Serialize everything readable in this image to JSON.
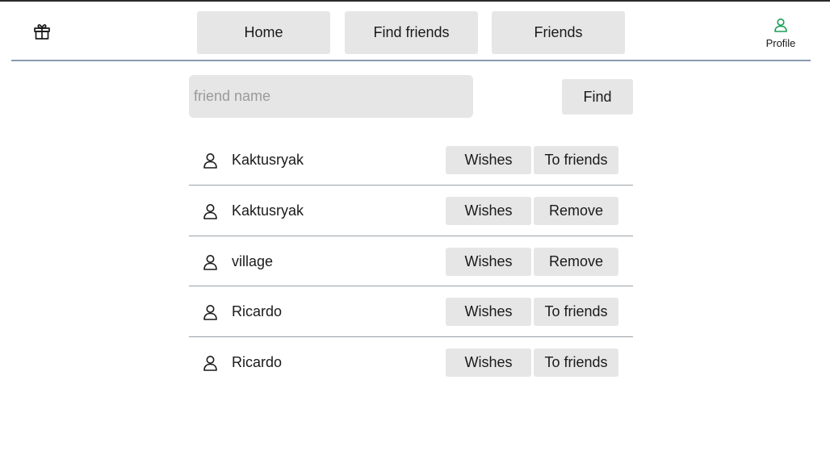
{
  "header": {
    "nav": [
      {
        "label": "Home"
      },
      {
        "label": "Find friends"
      },
      {
        "label": "Friends"
      }
    ],
    "profile_label": "Profile",
    "gift_icon": "gift-icon",
    "profile_icon": "user-icon",
    "profile_color": "#1a9e55"
  },
  "search": {
    "placeholder": "friend name",
    "value": "",
    "button_label": "Find"
  },
  "users": [
    {
      "name": "Kaktusryak",
      "wishes_label": "Wishes",
      "action_label": "To friends"
    },
    {
      "name": "Kaktusryak",
      "wishes_label": "Wishes",
      "action_label": "Remove"
    },
    {
      "name": "village",
      "wishes_label": "Wishes",
      "action_label": "Remove"
    },
    {
      "name": "Ricardo",
      "wishes_label": "Wishes",
      "action_label": "To friends"
    },
    {
      "name": "Ricardo",
      "wishes_label": "Wishes",
      "action_label": "To friends"
    }
  ]
}
